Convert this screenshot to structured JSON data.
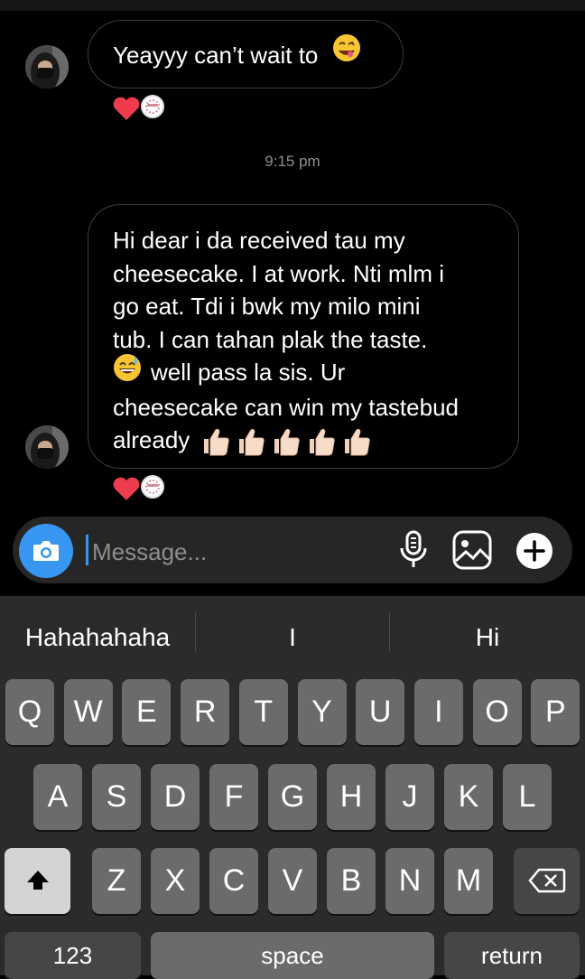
{
  "conversation": {
    "messages": [
      {
        "text": "Yeayyy can’t wait to",
        "emoji": "face-savoring-food"
      },
      {
        "text": "Hi dear i da received tau my cheesecake. I at work. Nti mlm i go eat. Tdi i bwk my milo mini tub. I can tahan plak the taste.",
        "text2": "well pass la sis. Ur cheesecake can win my tastebud already",
        "emoji_mid": "grinning-sweat-face",
        "emoji_end": "thumbs-up x5"
      }
    ],
    "timestamp": "9:15 pm",
    "reaction": "red-heart"
  },
  "lines": {
    "l1": "Hi dear i da received tau my",
    "l2": "cheesecake. I at work. Nti mlm i",
    "l3": "go eat. Tdi i bwk my milo mini",
    "l4": "tub. I can tahan plak the taste.",
    "l5": "well pass la sis. Ur",
    "l6": "cheesecake can win my tastebud",
    "l7": "already"
  },
  "composer": {
    "placeholder": "Message...",
    "icons": [
      "camera-icon",
      "microphone-icon",
      "gallery-icon",
      "plus-icon"
    ],
    "accent": "#3797f0"
  },
  "keyboard": {
    "suggestions": [
      "Hahahahaha",
      "I",
      "Hi"
    ],
    "row1": [
      "Q",
      "W",
      "E",
      "R",
      "T",
      "Y",
      "U",
      "I",
      "O",
      "P"
    ],
    "row2": [
      "A",
      "S",
      "D",
      "F",
      "G",
      "H",
      "J",
      "K",
      "L"
    ],
    "row3": [
      "Z",
      "X",
      "C",
      "V",
      "B",
      "N",
      "M"
    ],
    "numbers": "123",
    "space": "space",
    "return": "return"
  }
}
